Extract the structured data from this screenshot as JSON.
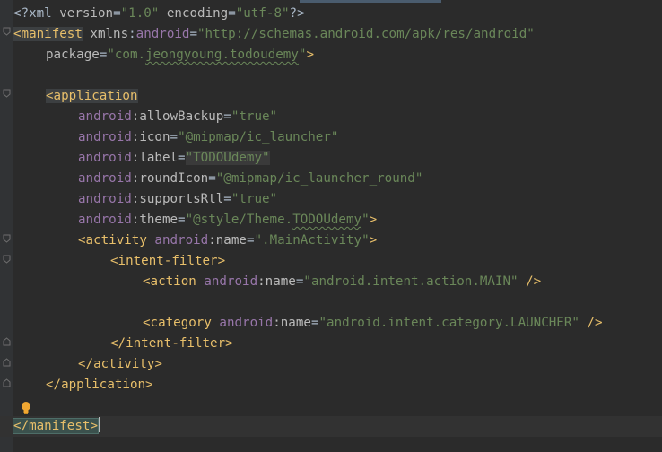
{
  "editor": {
    "file_language": "xml",
    "lines": {
      "l1_prolog": "<?xml",
      "l1_version_attr": " version",
      "l1_eq1": "=",
      "l1_version_val": "\"1.0\"",
      "l1_encoding_attr": " encoding",
      "l1_eq2": "=",
      "l1_encoding_val": "\"utf-8\"",
      "l1_end": "?>",
      "l2_tag": "<manifest",
      "l2_ns": " xmlns",
      "l2_colon": ":",
      "l2_attr": "android",
      "l2_eq": "=",
      "l2_val": "\"http://schemas.android.com/apk/res/android\"",
      "l3_attr": "package",
      "l3_eq": "=",
      "l3_val_q1": "\"com.",
      "l3_val_pkg": "jeongyoung.todoudemy",
      "l3_val_q2": "\"",
      "l3_close": ">",
      "l5_tag": "<application",
      "l6_ns": "android",
      "l6_attr": ":allowBackup",
      "l6_eq": "=",
      "l6_val": "\"true\"",
      "l7_ns": "android",
      "l7_attr": ":icon",
      "l7_eq": "=",
      "l7_val": "\"@mipmap/ic_launcher\"",
      "l8_ns": "android",
      "l8_attr": ":label",
      "l8_eq": "=",
      "l8_val": "\"TODOUdemy\"",
      "l9_ns": "android",
      "l9_attr": ":roundIcon",
      "l9_eq": "=",
      "l9_val": "\"@mipmap/ic_launcher_round\"",
      "l10_ns": "android",
      "l10_attr": ":supportsRtl",
      "l10_eq": "=",
      "l10_val": "\"true\"",
      "l11_ns": "android",
      "l11_attr": ":theme",
      "l11_eq": "=",
      "l11_val_a": "\"@style/Theme.",
      "l11_val_b": "TODOUdemy",
      "l11_val_c": "\"",
      "l11_close": ">",
      "l12_tag": "<activity",
      "l12_ns": " android",
      "l12_attr": ":name",
      "l12_eq": "=",
      "l12_val": "\".MainActivity\"",
      "l12_close": ">",
      "l13_tag": "<intent-filter>",
      "l14_tag": "<action",
      "l14_ns": " android",
      "l14_attr": ":name",
      "l14_eq": "=",
      "l14_val": "\"android.intent.action.MAIN\"",
      "l14_close": " />",
      "l16_tag": "<category",
      "l16_ns": " android",
      "l16_attr": ":name",
      "l16_eq": "=",
      "l16_val": "\"android.intent.category.LAUNCHER\"",
      "l16_close": " />",
      "l17_tag": "</intent-filter>",
      "l18_tag": "</activity>",
      "l19_tag": "</application>",
      "l21_tag_open": "</",
      "l21_tag_name": "manifest",
      "l21_tag_close": ">"
    }
  },
  "colors": {
    "background": "#2b2b2b",
    "gutter": "#313335",
    "tag": "#e8bf6a",
    "namespace": "#9876aa",
    "attribute": "#bababa",
    "string": "#6a8759"
  },
  "icons": {
    "fold_marker": "fold-icon",
    "intention_bulb": "lightbulb-icon"
  }
}
